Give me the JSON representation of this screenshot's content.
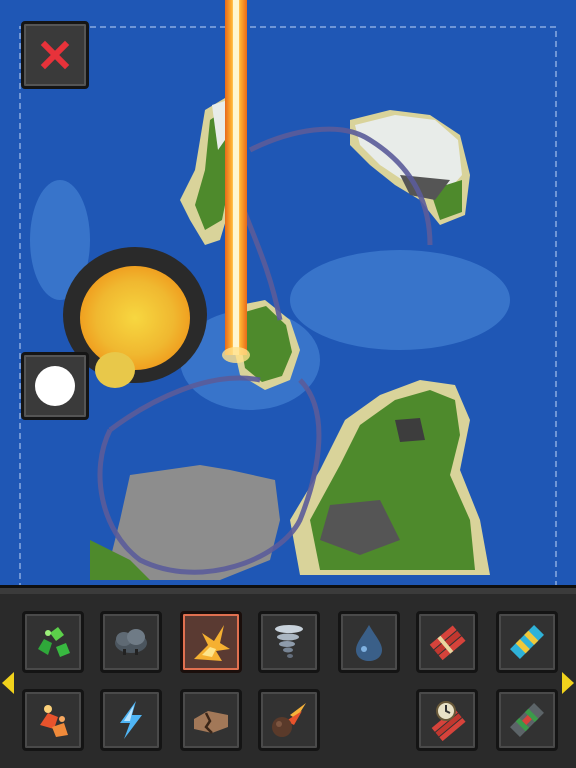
{
  "game": {
    "view": "world-map",
    "brush": "round"
  },
  "controls": {
    "close_icon": "close-icon",
    "brush_icon": "circle-brush-icon"
  },
  "toolbar": {
    "row1": [
      {
        "icon": "acid-icon"
      },
      {
        "icon": "rain-cloud-icon"
      },
      {
        "icon": "explosion-icon",
        "selected": true
      },
      {
        "icon": "tornado-icon"
      },
      {
        "icon": "water-drop-icon"
      },
      {
        "icon": "dynamite-icon"
      },
      {
        "icon": "tnt-icon"
      }
    ],
    "row2": [
      {
        "icon": "lava-icon"
      },
      {
        "icon": "lightning-icon"
      },
      {
        "icon": "crack-icon"
      },
      {
        "icon": "meteor-icon"
      },
      {
        "icon": "timed-bomb-icon"
      },
      {
        "icon": "mine-icon"
      }
    ]
  },
  "colors": {
    "ocean": "#1f57b5",
    "shallow": "#4a86d8",
    "grass": "#4e8a2c",
    "sand": "#d9cf8a",
    "snow": "#e8ece9",
    "laser": "#ff9a1c",
    "fire": "#f2c82a",
    "arrow": "#f1d21c"
  }
}
